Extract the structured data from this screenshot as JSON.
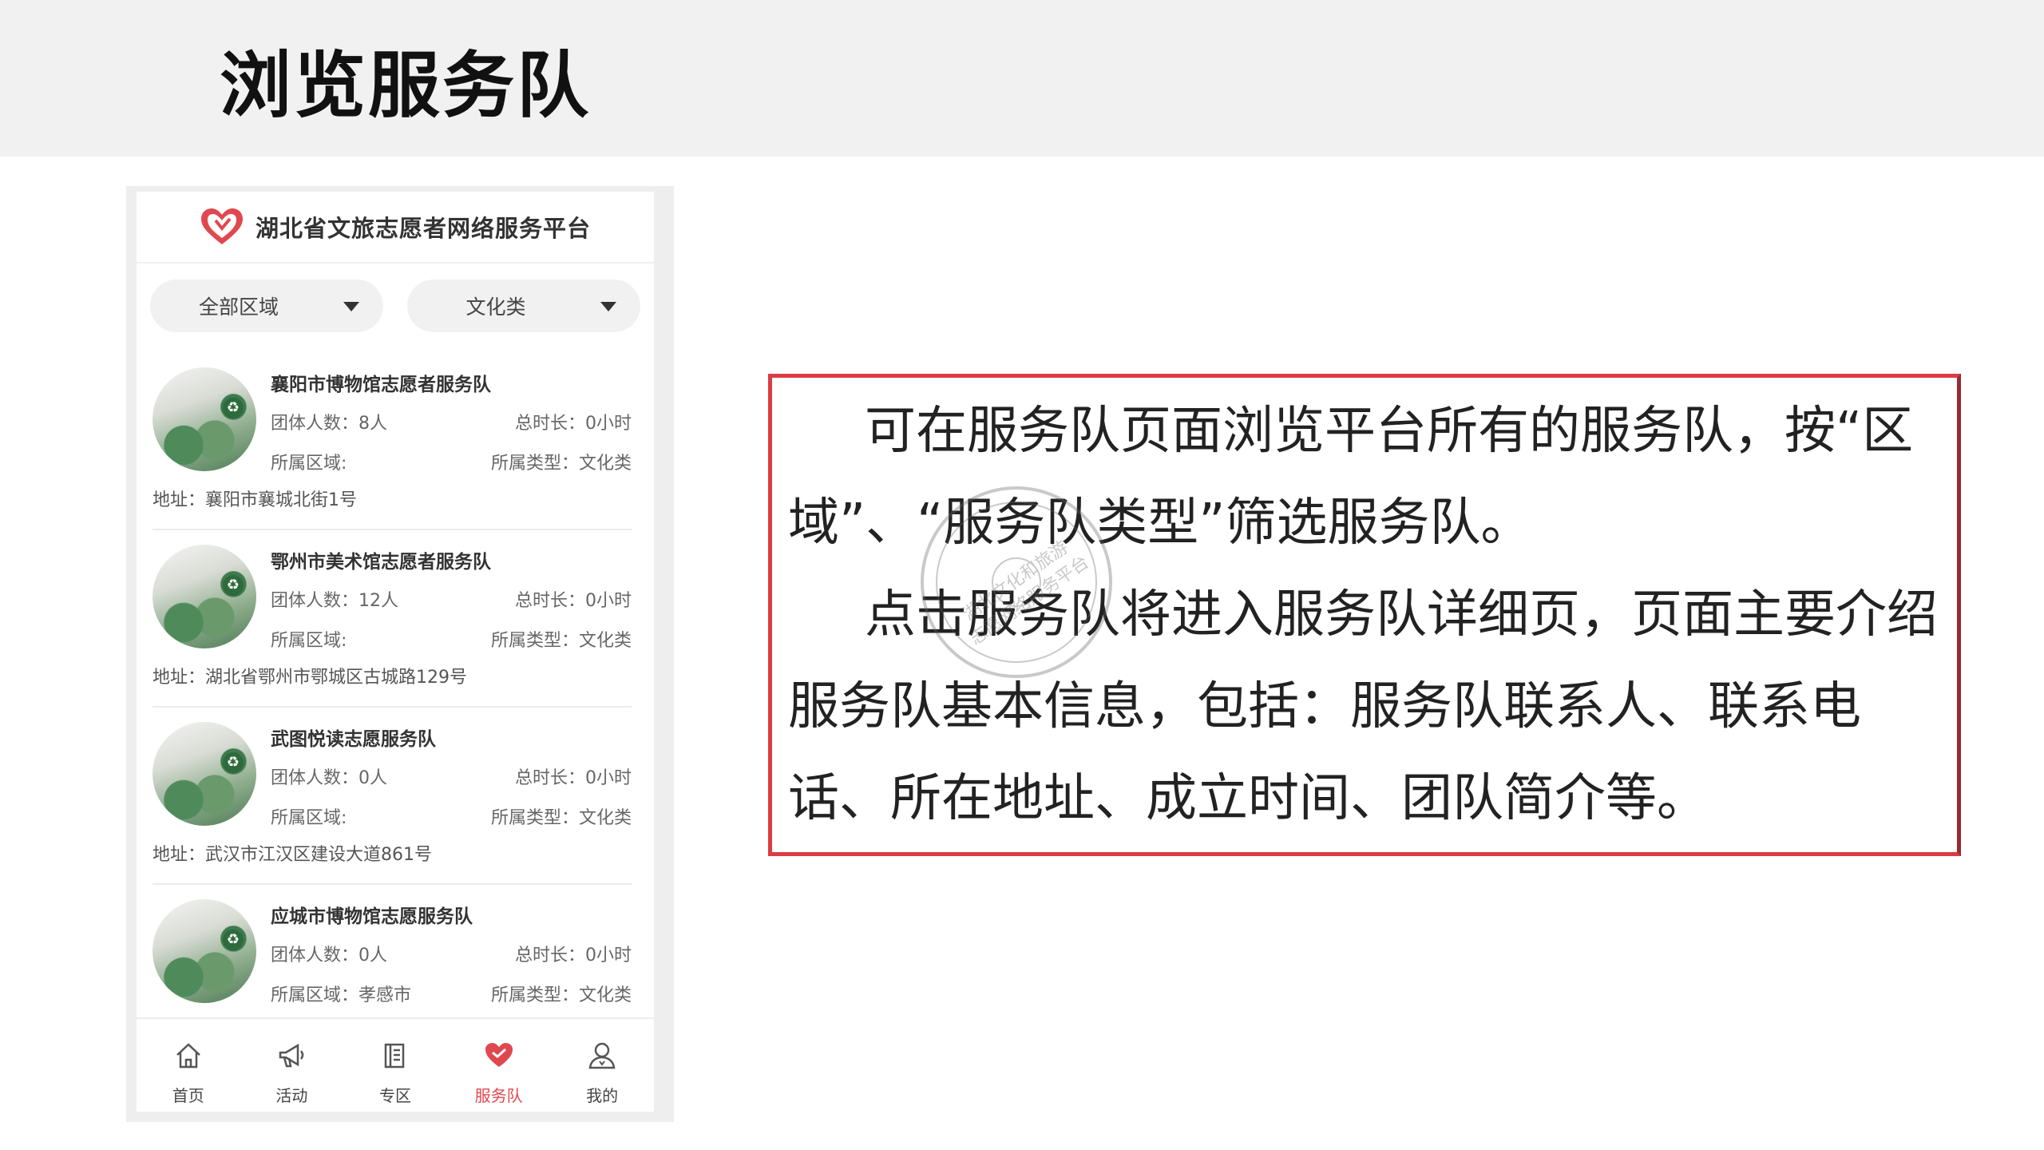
{
  "slide": {
    "title": "浏览服务队"
  },
  "app": {
    "title": "湖北省文旅志愿者网络服务平台"
  },
  "filters": {
    "region": "全部区域",
    "type": "文化类"
  },
  "teams": [
    {
      "name": "襄阳市博物馆志愿者服务队",
      "members": "团体人数：8人",
      "hours": "总时长：0小时",
      "region": "所属区域:",
      "type": "所属类型：文化类",
      "address": "地址：襄阳市襄城北街1号"
    },
    {
      "name": "鄂州市美术馆志愿者服务队",
      "members": "团体人数：12人",
      "hours": "总时长：0小时",
      "region": "所属区域:",
      "type": "所属类型：文化类",
      "address": "地址：湖北省鄂州市鄂城区古城路129号"
    },
    {
      "name": "武图悦读志愿服务队",
      "members": "团体人数：0人",
      "hours": "总时长：0小时",
      "region": "所属区域:",
      "type": "所属类型：文化类",
      "address": "地址：武汉市江汉区建设大道861号"
    },
    {
      "name": "应城市博物馆志愿服务队",
      "members": "团体人数：0人",
      "hours": "总时长：0小时",
      "region": "所属区域：孝感市",
      "type": "所属类型：文化类",
      "address": ""
    }
  ],
  "tabs": [
    {
      "label": "首页",
      "icon": "home-icon"
    },
    {
      "label": "活动",
      "icon": "megaphone-icon"
    },
    {
      "label": "专区",
      "icon": "book-icon"
    },
    {
      "label": "服务队",
      "icon": "heart-handshake-icon",
      "active": true
    },
    {
      "label": "我的",
      "icon": "user-icon"
    }
  ],
  "description": {
    "para1": "可在服务队页面浏览平台所有的服务队，按“区域”、“服务队类型”筛选服务队。",
    "para2": "点击服务队将进入服务队详细页，页面主要介绍服务队基本信息，包括：服务队联系人、联系电话、所在地址、成立时间、团队简介等。"
  },
  "seal": {
    "text": "湖北文化和旅游志愿网络服务平台"
  },
  "colors": {
    "accent": "#e0484f",
    "box_border": "#dd3b43",
    "header_band": "#f1f1f1"
  }
}
